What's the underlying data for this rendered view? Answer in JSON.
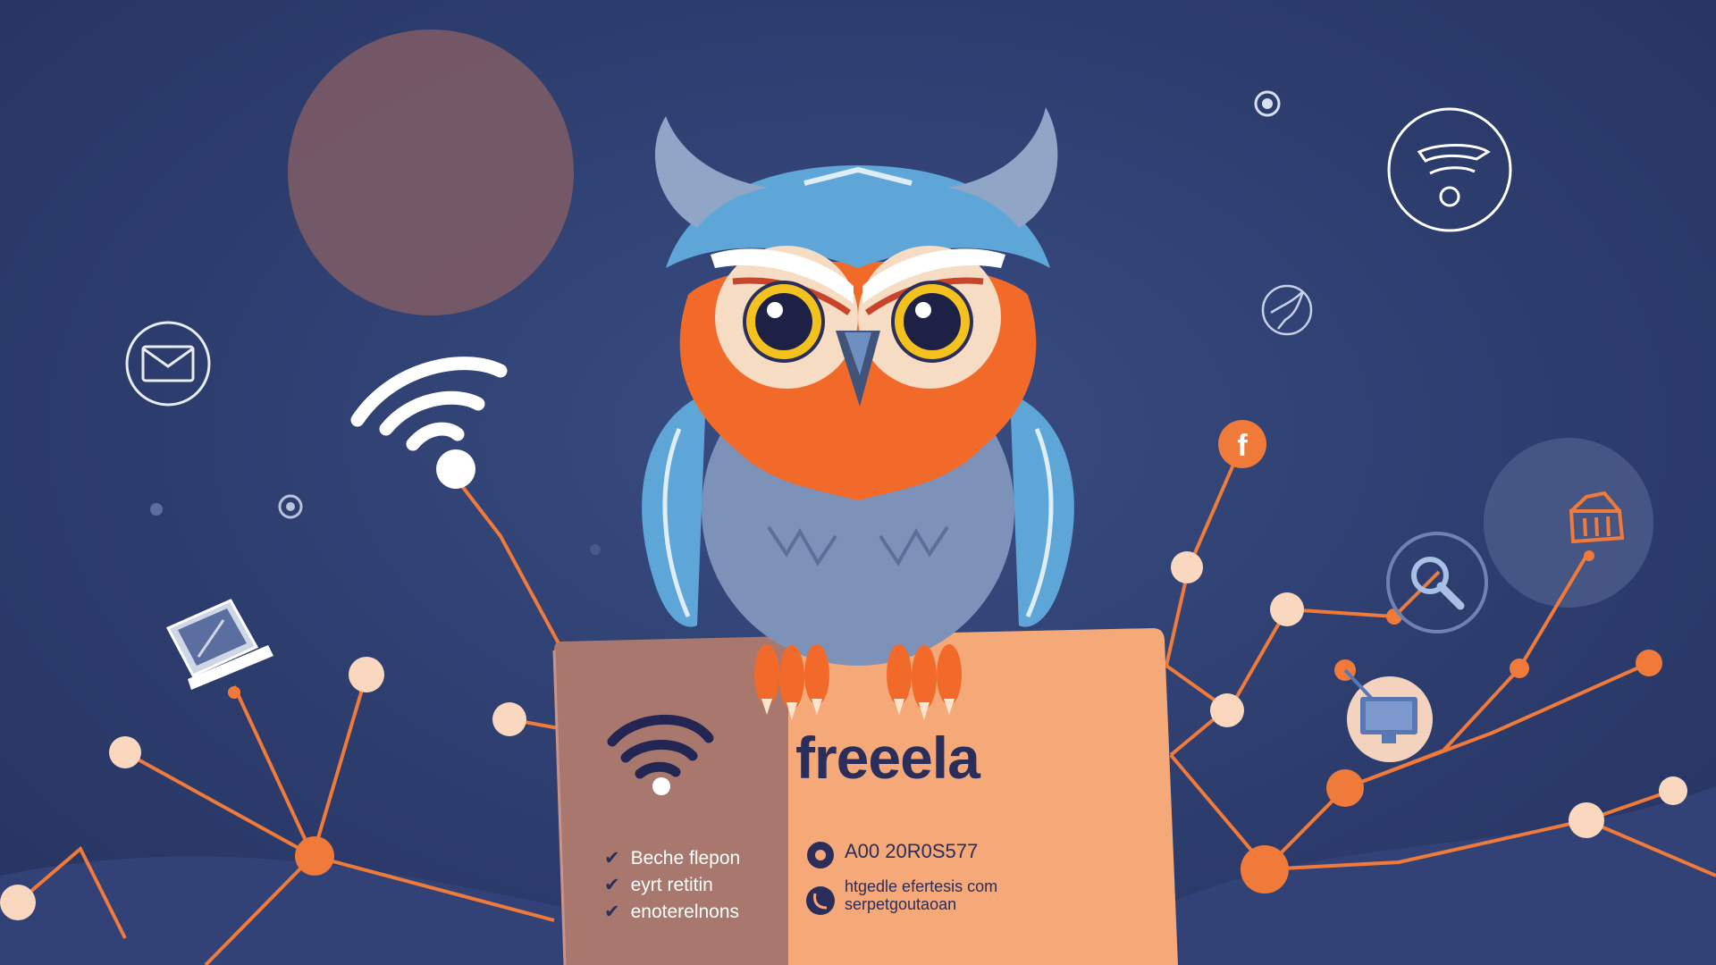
{
  "card": {
    "brand": "freeela",
    "checklist": [
      "Beche flepon",
      "eyrt retitin",
      "enoterelnons"
    ],
    "phone": "A00 20R0S577",
    "web_line1": "htgedle efertesis com",
    "web_line2": "serpetgoutaoan"
  },
  "icons": [
    "mail-icon",
    "wifi-icon",
    "laptop-icon",
    "facebook-icon",
    "search-icon",
    "monitor-icon",
    "building-icon",
    "bird-icon",
    "wifi-badge-icon"
  ],
  "colors": {
    "background": "#2d3d6e",
    "accent": "#f07a3a",
    "owl_blue": "#5ea6d8",
    "owl_orange": "#f26a2a",
    "card_left": "#a9766d",
    "card_right": "#f5a878",
    "node": "#f9d8bf"
  }
}
